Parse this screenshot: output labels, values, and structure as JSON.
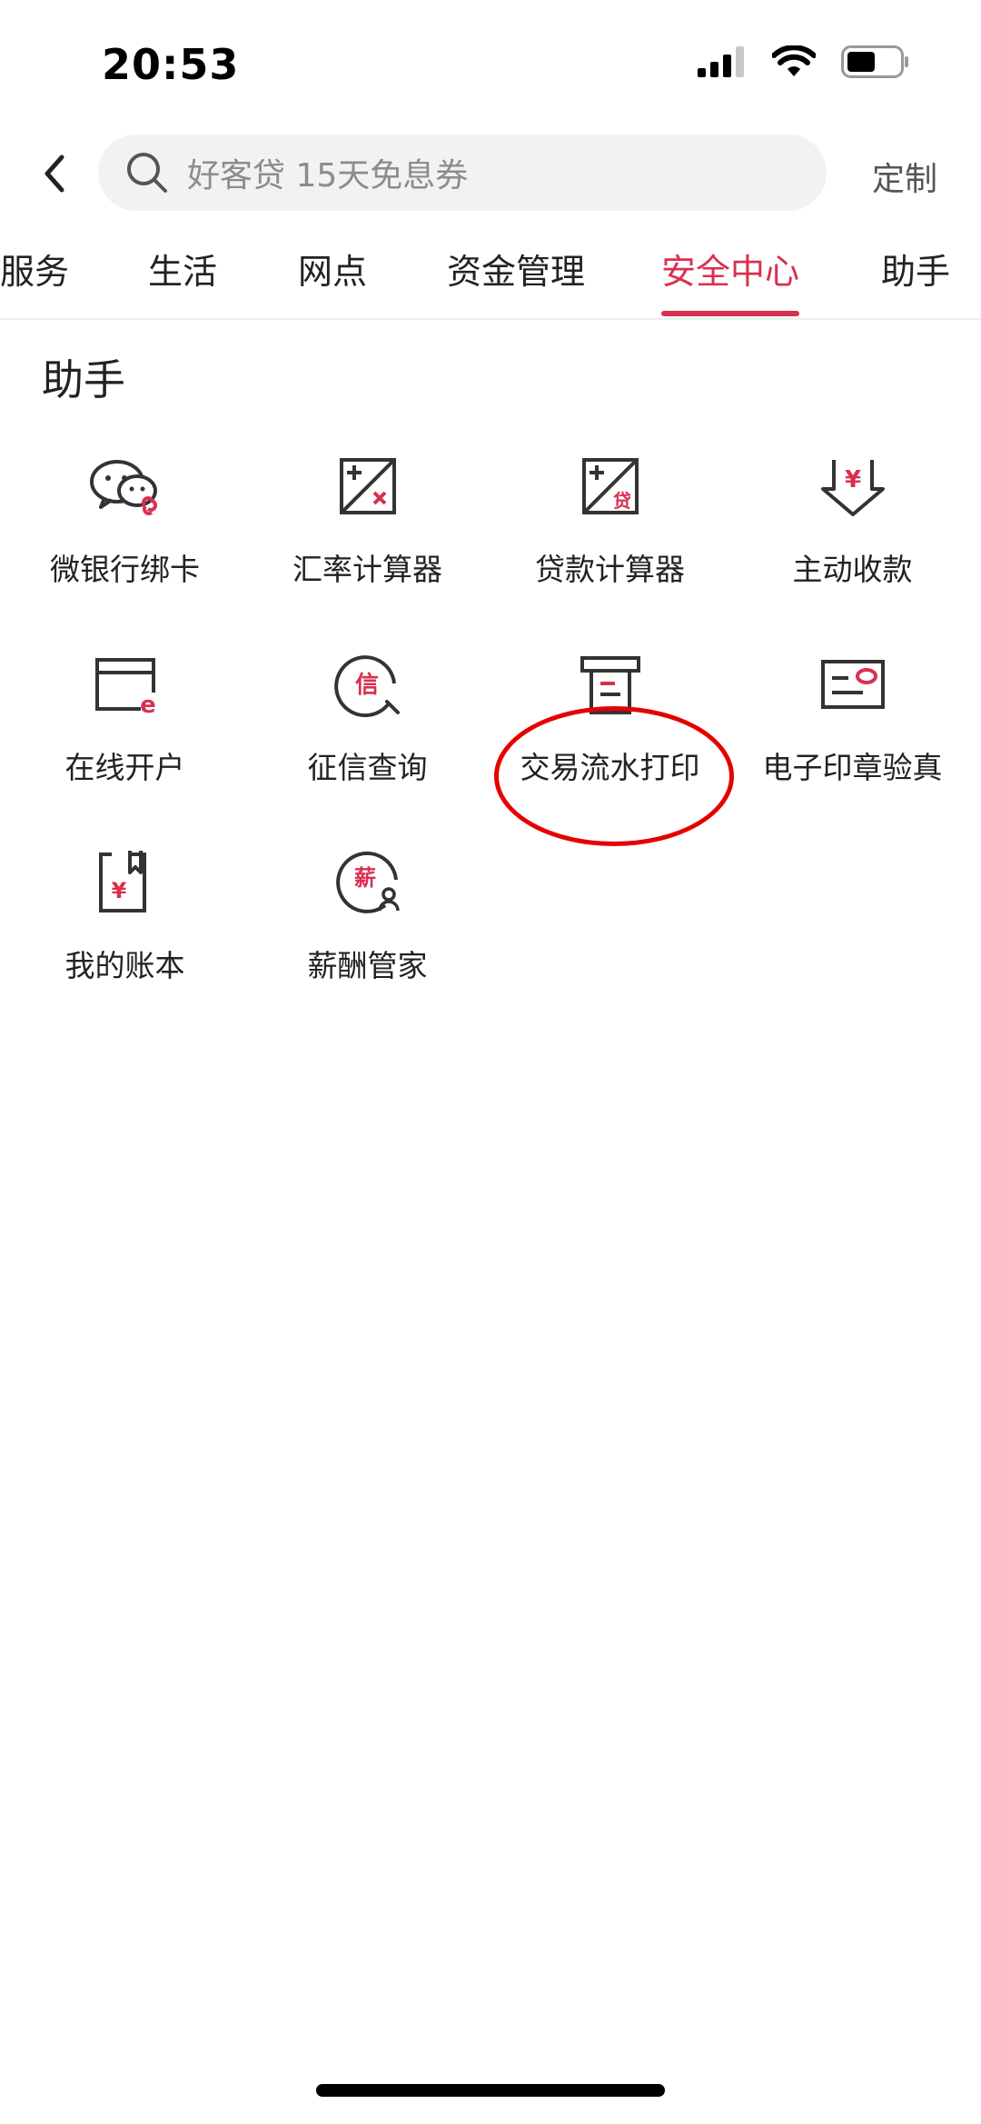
{
  "status_bar": {
    "time": "20:53",
    "icons": [
      "signal-icon",
      "wifi-icon",
      "battery-icon"
    ]
  },
  "header": {
    "back_icon": "chevron-left-icon",
    "search_icon": "search-icon",
    "search_placeholder": "好客贷 15天免息券",
    "customize_label": "定制"
  },
  "tabs": [
    {
      "label": "服务",
      "active": false
    },
    {
      "label": "生活",
      "active": false
    },
    {
      "label": "网点",
      "active": false
    },
    {
      "label": "资金管理",
      "active": false
    },
    {
      "label": "安全中心",
      "active": true
    },
    {
      "label": "助手",
      "active": false
    }
  ],
  "section": {
    "title": "助手",
    "items": [
      {
        "label": "微银行绑卡",
        "icon": "wechat-link-icon"
      },
      {
        "label": "汇率计算器",
        "icon": "exchange-calculator-icon"
      },
      {
        "label": "贷款计算器",
        "icon": "loan-calculator-icon"
      },
      {
        "label": "主动收款",
        "icon": "receive-payment-icon"
      },
      {
        "label": "在线开户",
        "icon": "online-account-icon"
      },
      {
        "label": "征信查询",
        "icon": "credit-inquiry-icon"
      },
      {
        "label": "交易流水打印",
        "icon": "printer-icon"
      },
      {
        "label": "电子印章验真",
        "icon": "e-seal-verify-icon"
      },
      {
        "label": "我的账本",
        "icon": "ledger-icon"
      },
      {
        "label": "薪酬管家",
        "icon": "salary-manager-icon"
      }
    ],
    "icon_glyphs": {
      "yuan": "¥",
      "loan": "贷",
      "credit": "信",
      "salary": "薪",
      "online": "e"
    }
  },
  "colors": {
    "accent": "#d9304f",
    "icon_stroke": "#333333",
    "annotation": "#e60000"
  }
}
